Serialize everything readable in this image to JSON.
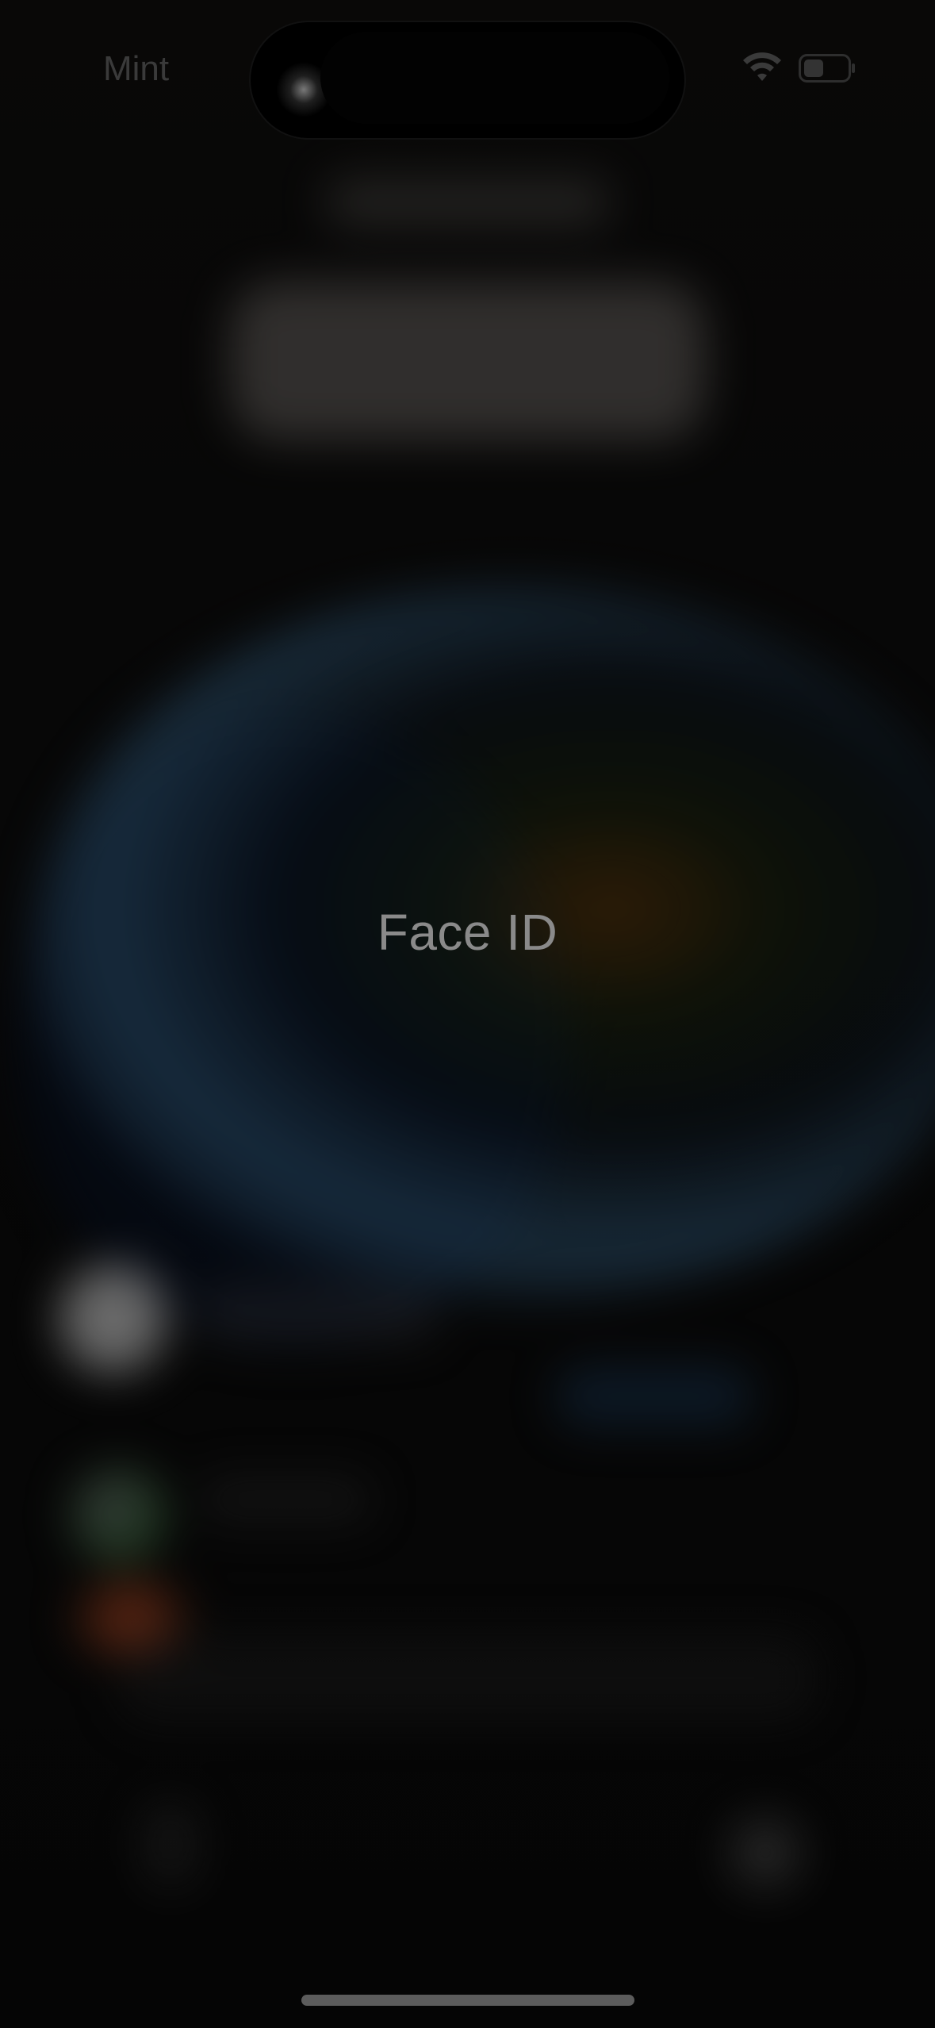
{
  "status_bar": {
    "carrier": "Mint",
    "wifi_icon": "wifi-icon",
    "battery_icon": "battery-icon"
  },
  "face_id": {
    "label": "Face ID"
  },
  "colors": {
    "label_gray": "#8a8a8a",
    "background": "#080808"
  }
}
